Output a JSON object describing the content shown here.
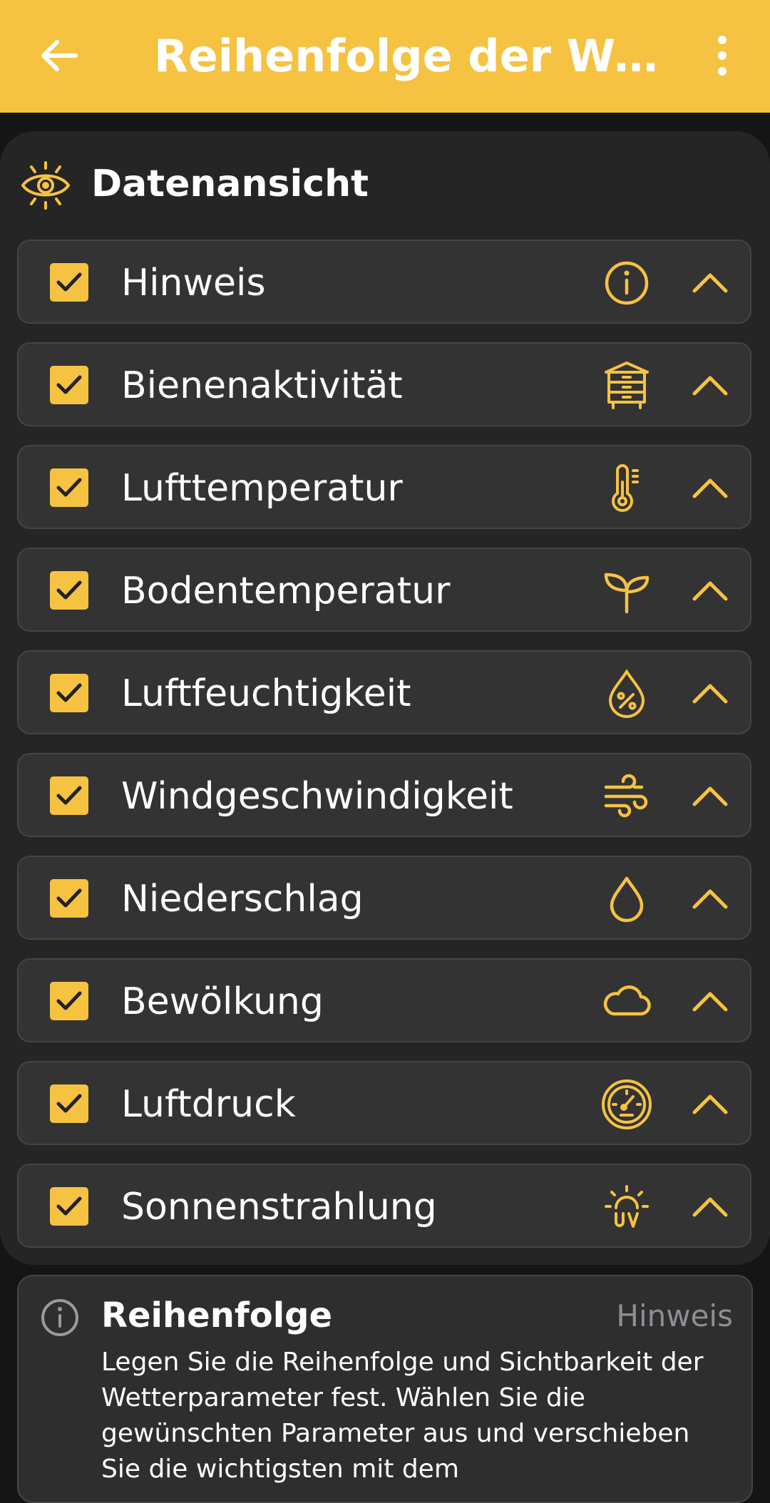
{
  "appbar": {
    "title": "Reihenfolge der Wette…",
    "back_icon": "arrow-left-icon",
    "menu_icon": "more-vertical-icon"
  },
  "section": {
    "title": "Datenansicht",
    "icon": "eye-icon"
  },
  "items": [
    {
      "label": "Hinweis",
      "icon": "info-circle-icon",
      "checked": true
    },
    {
      "label": "Bienenaktivität",
      "icon": "beehive-icon",
      "checked": true
    },
    {
      "label": "Lufttemperatur",
      "icon": "thermometer-icon",
      "checked": true
    },
    {
      "label": "Bodentemperatur",
      "icon": "sprout-icon",
      "checked": true
    },
    {
      "label": "Luftfeuchtigkeit",
      "icon": "humidity-drop-icon",
      "checked": true
    },
    {
      "label": "Windgeschwindigkeit",
      "icon": "wind-icon",
      "checked": true
    },
    {
      "label": "Niederschlag",
      "icon": "drop-icon",
      "checked": true
    },
    {
      "label": "Bewölkung",
      "icon": "cloud-icon",
      "checked": true
    },
    {
      "label": "Luftdruck",
      "icon": "gauge-icon",
      "checked": true
    },
    {
      "label": "Sonnenstrahlung",
      "icon": "uv-sun-icon",
      "checked": true
    }
  ],
  "info": {
    "title": "Reihenfolge",
    "tag": "Hinweis",
    "text": "Legen Sie die Reihenfolge und Sichtbarkeit der Wetterparameter fest. Wählen Sie die gewünschten Parameter aus und verschieben Sie die wichtigsten mit dem"
  },
  "colors": {
    "accent": "#F5C242",
    "background": "#151515",
    "card": "#252525",
    "row": "#333333"
  }
}
